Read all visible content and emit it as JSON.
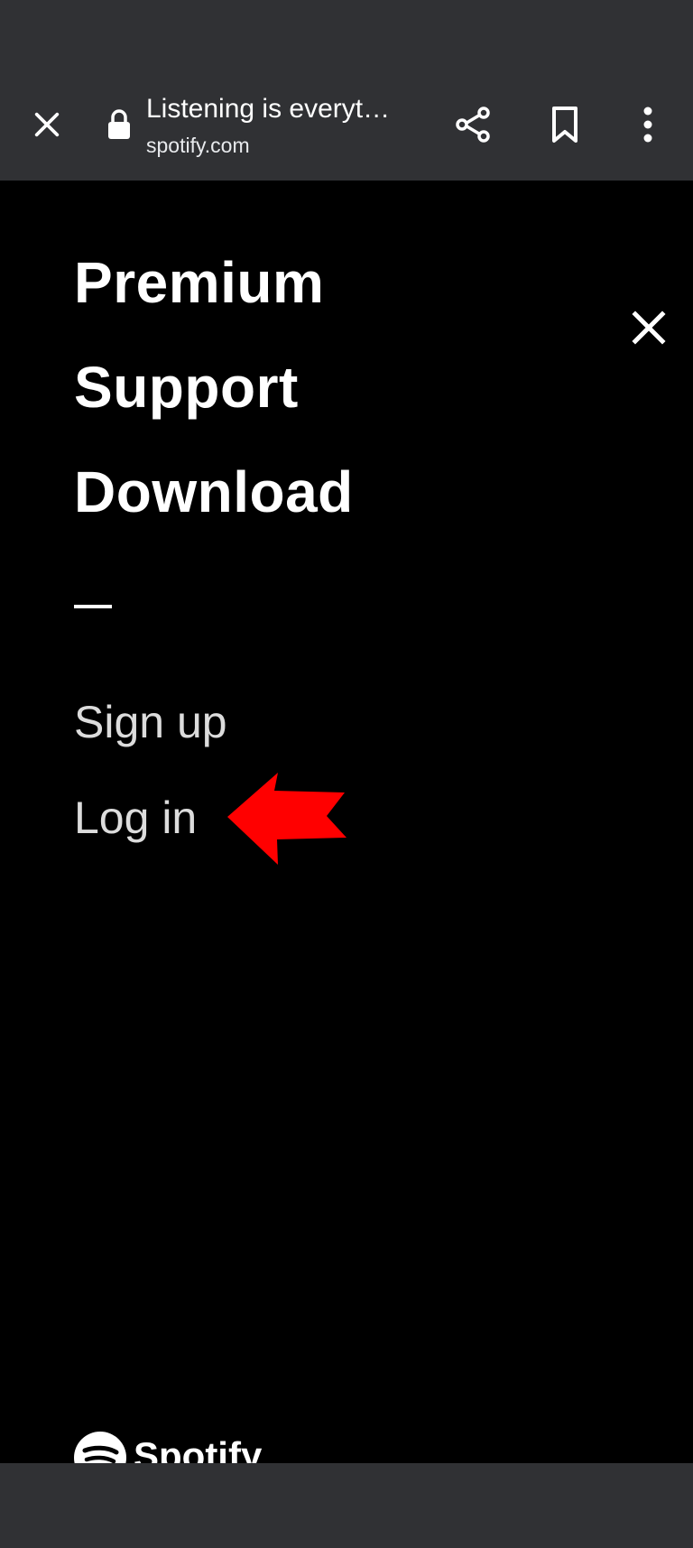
{
  "browser": {
    "page_title": "Listening is everyt…",
    "url": "spotify.com",
    "icons": {
      "close": "close-icon",
      "lock": "lock-icon",
      "share": "share-icon",
      "bookmark": "bookmark-icon",
      "more": "more-vert-icon"
    }
  },
  "menu": {
    "primary": [
      {
        "label": "Premium"
      },
      {
        "label": "Support"
      },
      {
        "label": "Download"
      }
    ],
    "divider": "—",
    "secondary": [
      {
        "label": "Sign up"
      },
      {
        "label": "Log in"
      }
    ],
    "close_icon": "close-icon",
    "annotation": {
      "type": "arrow",
      "color": "#ff0000",
      "points_to": "Log in"
    }
  },
  "footer": {
    "logo_text": "Spotify"
  },
  "colors": {
    "browser_chrome": "#303134",
    "page_background": "#000000",
    "text_primary": "#ffffff",
    "text_secondary": "#dcdcdc",
    "annotation": "#ff0000"
  }
}
